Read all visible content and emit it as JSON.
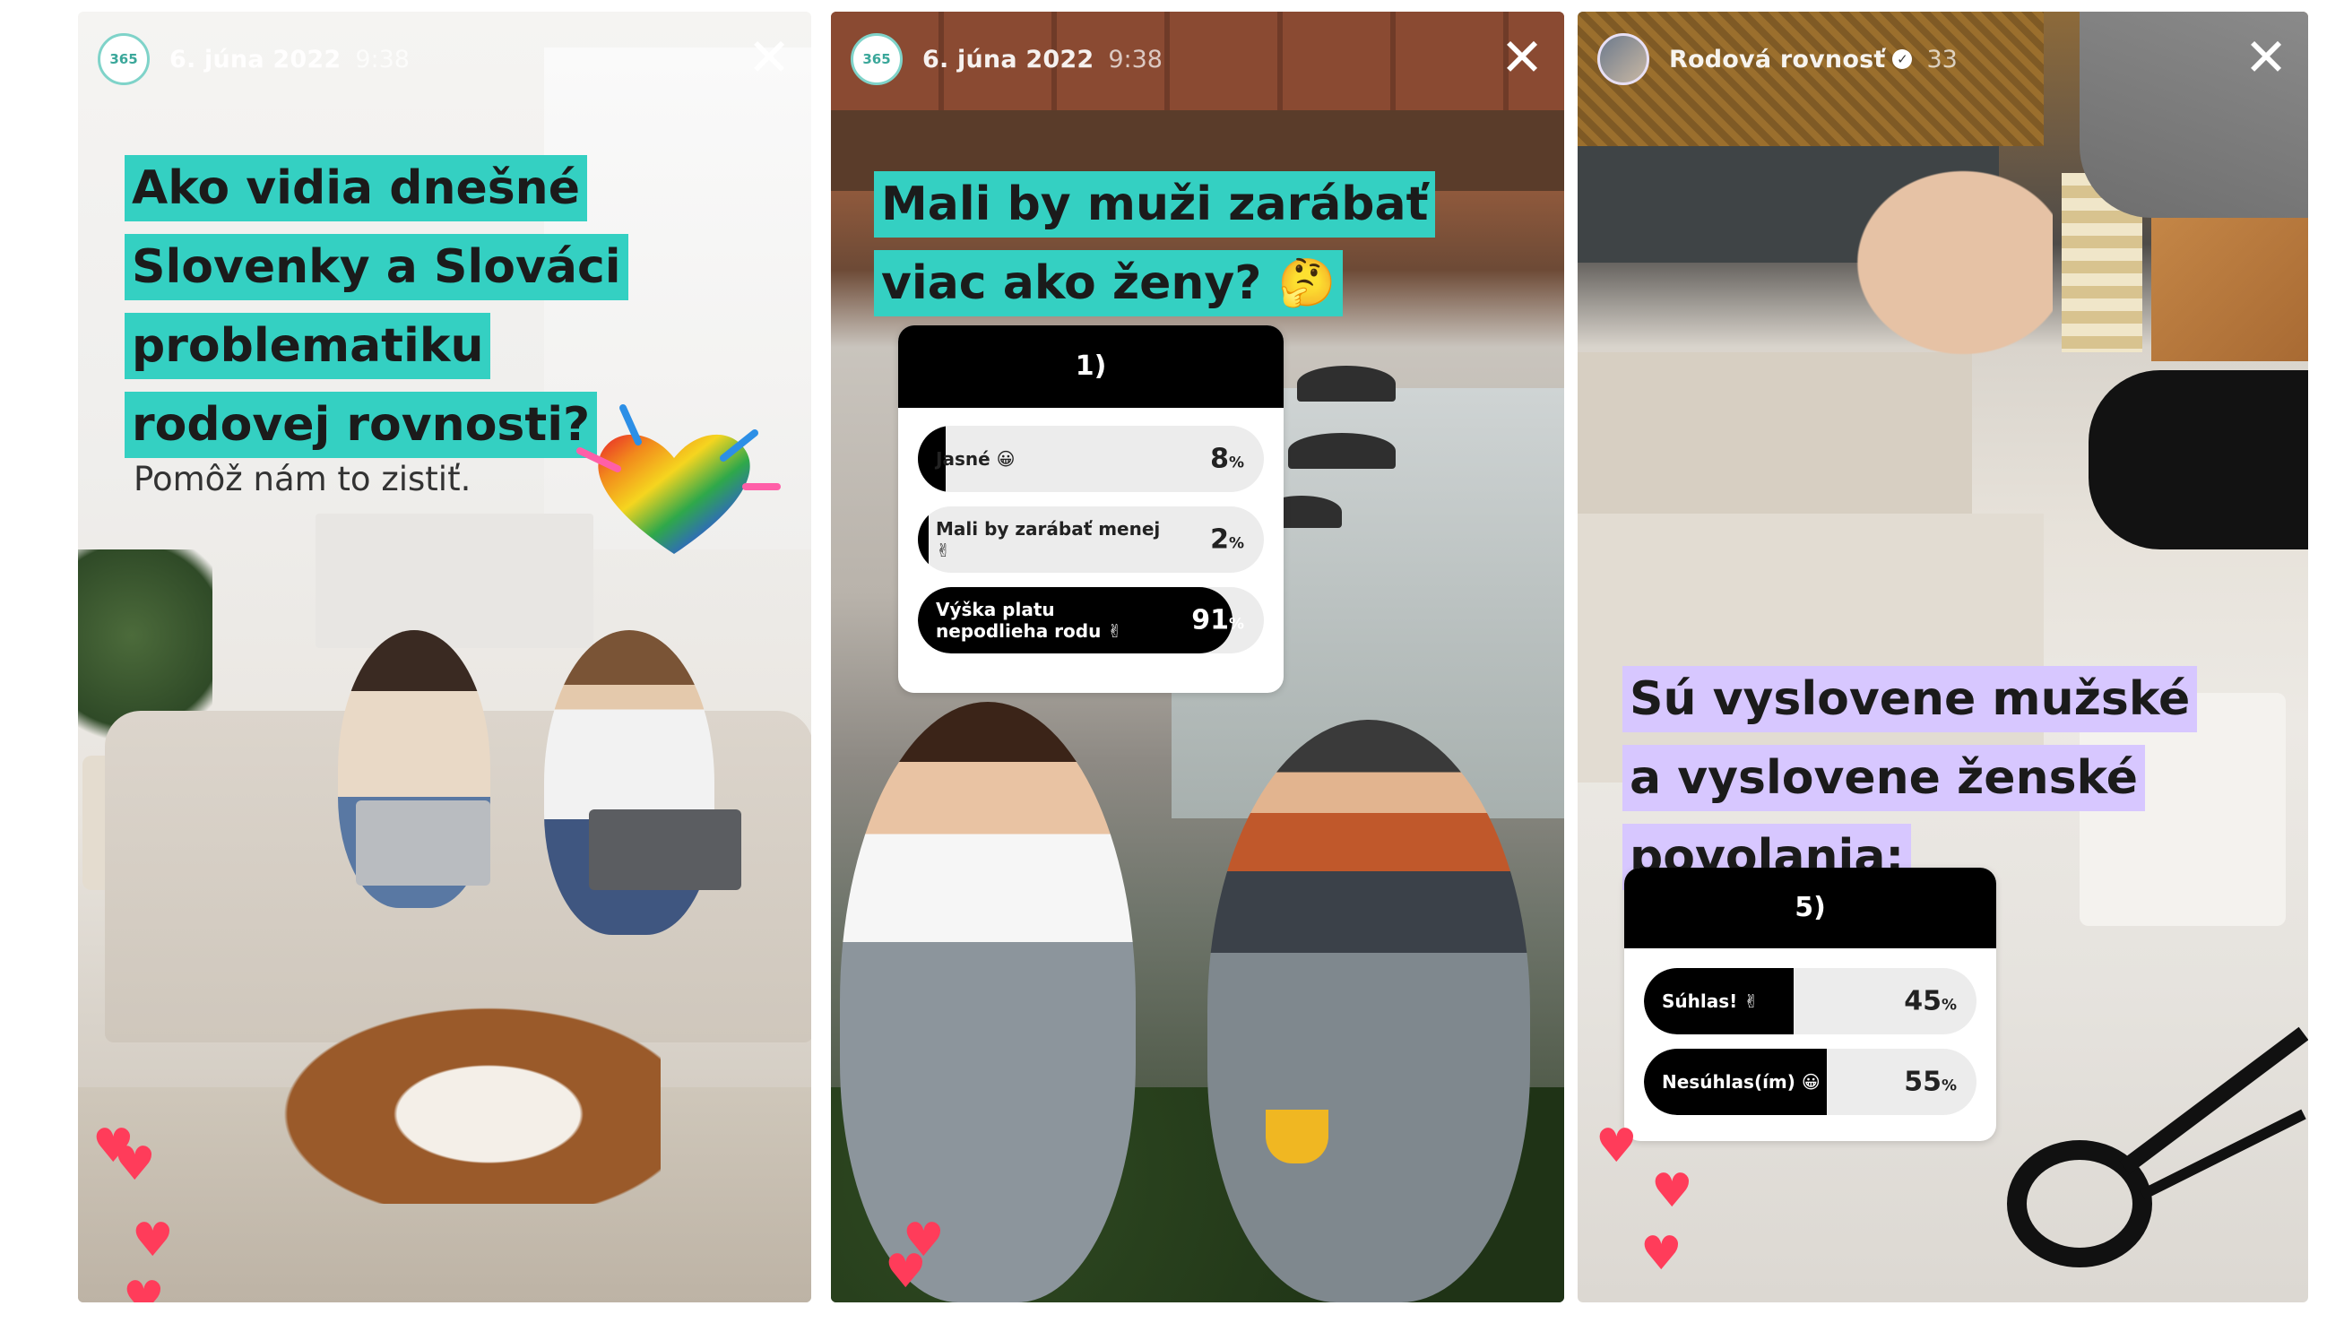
{
  "stories": [
    {
      "header": {
        "date": "6. júna 2022",
        "time": "9:38",
        "avatar_text": "365"
      },
      "headline": [
        "Ako vidia dnešné",
        "Slovenky a Slováci",
        "problematiku",
        "rodovej rovnosti?"
      ],
      "subtext": "Pomôž nám to zistiť.",
      "highlight_color": "#34d0c2",
      "sticker": "rainbow-heart"
    },
    {
      "header": {
        "date": "6. júna 2022",
        "time": "9:38",
        "avatar_text": "365"
      },
      "headline": [
        "Mali by muži zarábať",
        "viac ako ženy? 🤔"
      ],
      "highlight_color": "#34d0c2",
      "poll": {
        "question": "1)",
        "options": [
          {
            "label": "Jasné 😀",
            "percent": 8,
            "pct_text": "8"
          },
          {
            "label": "Mali by zarábať menej ✌",
            "percent": 2,
            "pct_text": "2"
          },
          {
            "label": "Výška platu nepodlieha rodu ✌",
            "percent": 91,
            "pct_text": "91"
          }
        ]
      }
    },
    {
      "header": {
        "name": "Rodová rovnosť",
        "time": "33"
      },
      "headline": [
        "Sú vyslovene mužské",
        "a vyslovene ženské",
        "povolania:"
      ],
      "highlight_color": "#d7c7ff",
      "poll": {
        "question": "5)",
        "options": [
          {
            "label": "Súhlas! ✌",
            "percent": 45,
            "pct_text": "45"
          },
          {
            "label": "Nesúhlas(ím) 😀",
            "percent": 55,
            "pct_text": "55"
          }
        ]
      }
    }
  ],
  "percent_sign": "%",
  "close_glyph": "✕",
  "heart_glyph": "♥",
  "verified_glyph": "✓"
}
